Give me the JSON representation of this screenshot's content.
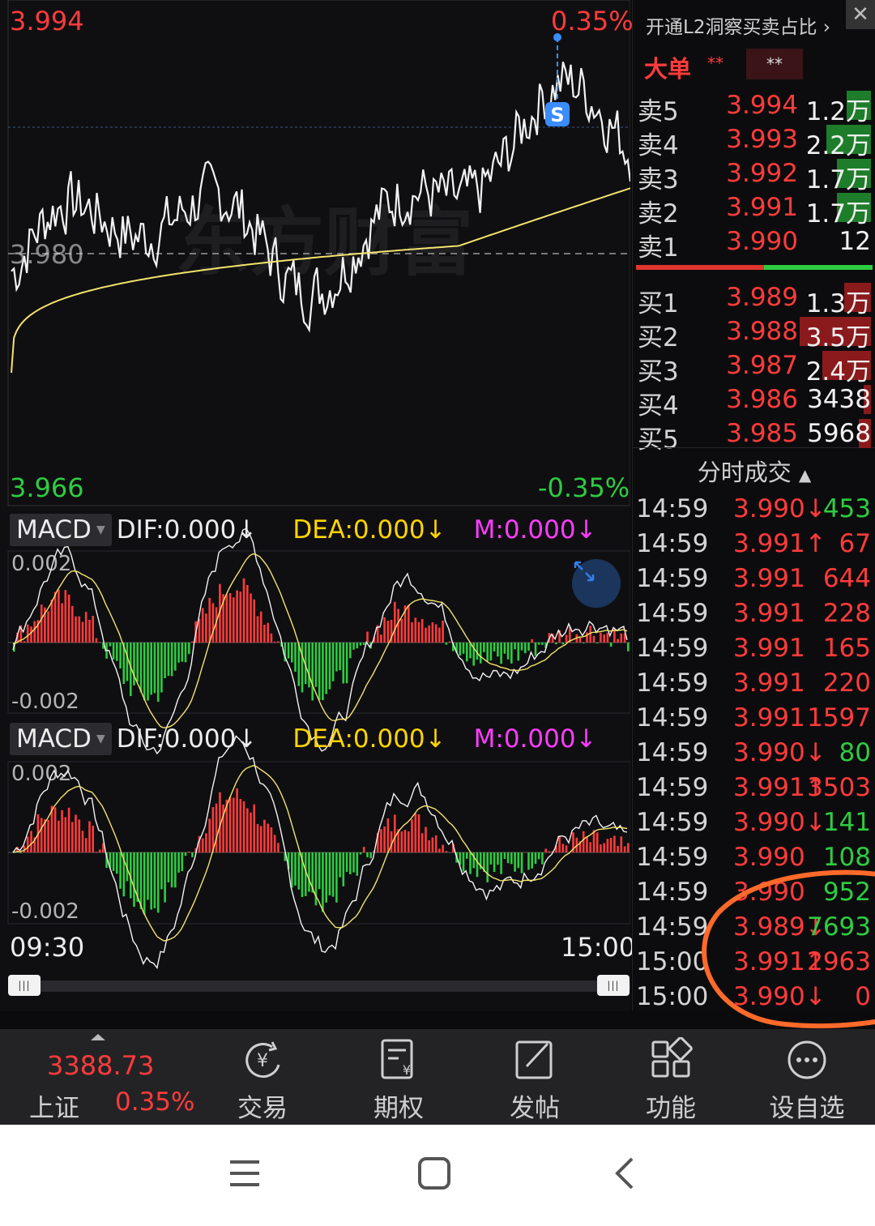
{
  "chart": {
    "price_high": "3.994",
    "price_low": "3.966",
    "pct_high": "0.35%",
    "pct_low": "-0.35%",
    "base_price": "3.980",
    "watermark": "东方财富",
    "signal_marker": "S",
    "time_start": "09:30",
    "time_end": "15:00",
    "colors": {
      "up": "#ff3b3b",
      "down": "#2ecc40",
      "avg_line": "#f3e36a",
      "price_line": "#f2f2f2"
    }
  },
  "macd_panels": [
    {
      "button": "MACD",
      "dif": "DIF:0.000",
      "dea": "DEA:0.000",
      "m": "M:0.000",
      "arrow": "↓",
      "top_label": "0.002",
      "bottom_label": "-0.002"
    },
    {
      "button": "MACD",
      "dif": "DIF:0.000",
      "dea": "DEA:0.000",
      "m": "M:0.000",
      "arrow": "↓",
      "top_label": "0.002",
      "bottom_label": "-0.002"
    }
  ],
  "panel": {
    "l2_link": "开通L2洞察买卖占比 ›",
    "close": "✕",
    "big_order": "大单",
    "stars": "**",
    "stars_value": "**",
    "sell": [
      {
        "label": "卖5",
        "price": "3.994",
        "vol": "1.2万",
        "bar": "green",
        "fill": 0.34
      },
      {
        "label": "卖4",
        "price": "3.993",
        "vol": "2.2万",
        "bar": "green",
        "fill": 0.62
      },
      {
        "label": "卖3",
        "price": "3.992",
        "vol": "1.7万",
        "bar": "green",
        "fill": 0.48
      },
      {
        "label": "卖2",
        "price": "3.991",
        "vol": "1.7万",
        "bar": "green",
        "fill": 0.48
      },
      {
        "label": "卖1",
        "price": "3.990",
        "vol": "12",
        "bar": "green",
        "fill": 0
      }
    ],
    "buy": [
      {
        "label": "买1",
        "price": "3.989",
        "vol": "1.3万",
        "bar": "red",
        "fill": 0.37
      },
      {
        "label": "买2",
        "price": "3.988",
        "vol": "3.5万",
        "bar": "red",
        "fill": 1.0
      },
      {
        "label": "买3",
        "price": "3.987",
        "vol": "2.4万",
        "bar": "red",
        "fill": 0.68
      },
      {
        "label": "买4",
        "price": "3.986",
        "vol": "3438",
        "bar": "red",
        "fill": 0.1
      },
      {
        "label": "买5",
        "price": "3.985",
        "vol": "5968",
        "bar": "red",
        "fill": 0.17
      }
    ],
    "ticks_title": "分时成交",
    "ticks": [
      {
        "time": "14:59",
        "price": "3.990↓",
        "vol": "453",
        "dir": "down"
      },
      {
        "time": "14:59",
        "price": "3.991↑",
        "vol": "67",
        "dir": "up"
      },
      {
        "time": "14:59",
        "price": "3.991",
        "vol": "644",
        "dir": "up"
      },
      {
        "time": "14:59",
        "price": "3.991",
        "vol": "228",
        "dir": "up"
      },
      {
        "time": "14:59",
        "price": "3.991",
        "vol": "165",
        "dir": "up"
      },
      {
        "time": "14:59",
        "price": "3.991",
        "vol": "220",
        "dir": "up"
      },
      {
        "time": "14:59",
        "price": "3.991",
        "vol": "1597",
        "dir": "up"
      },
      {
        "time": "14:59",
        "price": "3.990↓",
        "vol": "80",
        "dir": "down"
      },
      {
        "time": "14:59",
        "price": "3.991↑",
        "vol": "3503",
        "dir": "up"
      },
      {
        "time": "14:59",
        "price": "3.990↓",
        "vol": "141",
        "dir": "down"
      },
      {
        "time": "14:59",
        "price": "3.990",
        "vol": "108",
        "dir": "down"
      },
      {
        "time": "14:59",
        "price": "3.990",
        "vol": "952",
        "dir": "down"
      },
      {
        "time": "14:59",
        "price": "3.989↓",
        "vol": "7693",
        "dir": "down"
      },
      {
        "time": "15:00",
        "price": "3.991↑",
        "vol": "2963",
        "dir": "up"
      },
      {
        "time": "15:00",
        "price": "3.990↓",
        "vol": "0",
        "dir": "up"
      }
    ]
  },
  "bottom": {
    "index_value": "3388.73",
    "index_name": "上证",
    "index_pct": "0.35%",
    "nav": [
      {
        "label": "交易",
        "icon": "trade-icon"
      },
      {
        "label": "期权",
        "icon": "options-icon"
      },
      {
        "label": "发帖",
        "icon": "post-icon"
      },
      {
        "label": "功能",
        "icon": "apps-icon"
      },
      {
        "label": "设自选",
        "icon": "more-icon"
      }
    ]
  }
}
